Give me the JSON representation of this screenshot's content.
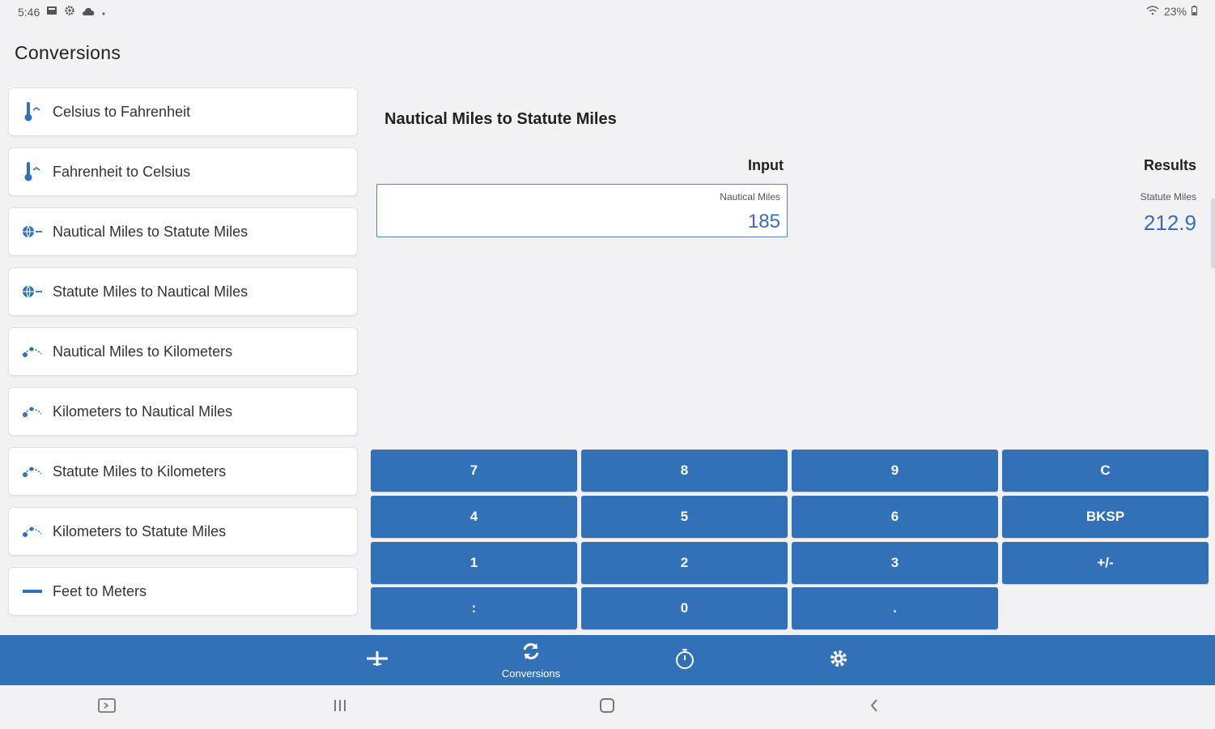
{
  "status": {
    "time": "5:46",
    "battery": "23%"
  },
  "page_title": "Conversions",
  "conversions": [
    {
      "label": "Celsius to Fahrenheit",
      "icon": "thermometer-icon"
    },
    {
      "label": "Fahrenheit to Celsius",
      "icon": "thermometer-icon"
    },
    {
      "label": "Nautical Miles to Statute Miles",
      "icon": "globe-icon"
    },
    {
      "label": "Statute Miles to Nautical Miles",
      "icon": "globe-icon"
    },
    {
      "label": "Nautical Miles to Kilometers",
      "icon": "route-icon"
    },
    {
      "label": "Kilometers to Nautical Miles",
      "icon": "route-icon"
    },
    {
      "label": "Statute Miles to Kilometers",
      "icon": "route-icon"
    },
    {
      "label": "Kilometers to Statute Miles",
      "icon": "route-icon"
    },
    {
      "label": "Feet to Meters",
      "icon": "ruler-icon"
    }
  ],
  "calculator": {
    "title": "Nautical Miles to Statute Miles",
    "input_label": "Input",
    "results_label": "Results",
    "input_unit": "Nautical Miles",
    "input_value": "185",
    "result_unit": "Statute Miles",
    "result_value": "212.9"
  },
  "keys": [
    "7",
    "8",
    "9",
    "C",
    "4",
    "5",
    "6",
    "BKSP",
    "1",
    "2",
    "3",
    "+/-",
    ":",
    "0",
    "."
  ],
  "nav": {
    "conversions_label": "Conversions"
  },
  "colors": {
    "accent": "#3271b8",
    "value_text": "#3a6db4",
    "background": "#f2f2f4"
  }
}
